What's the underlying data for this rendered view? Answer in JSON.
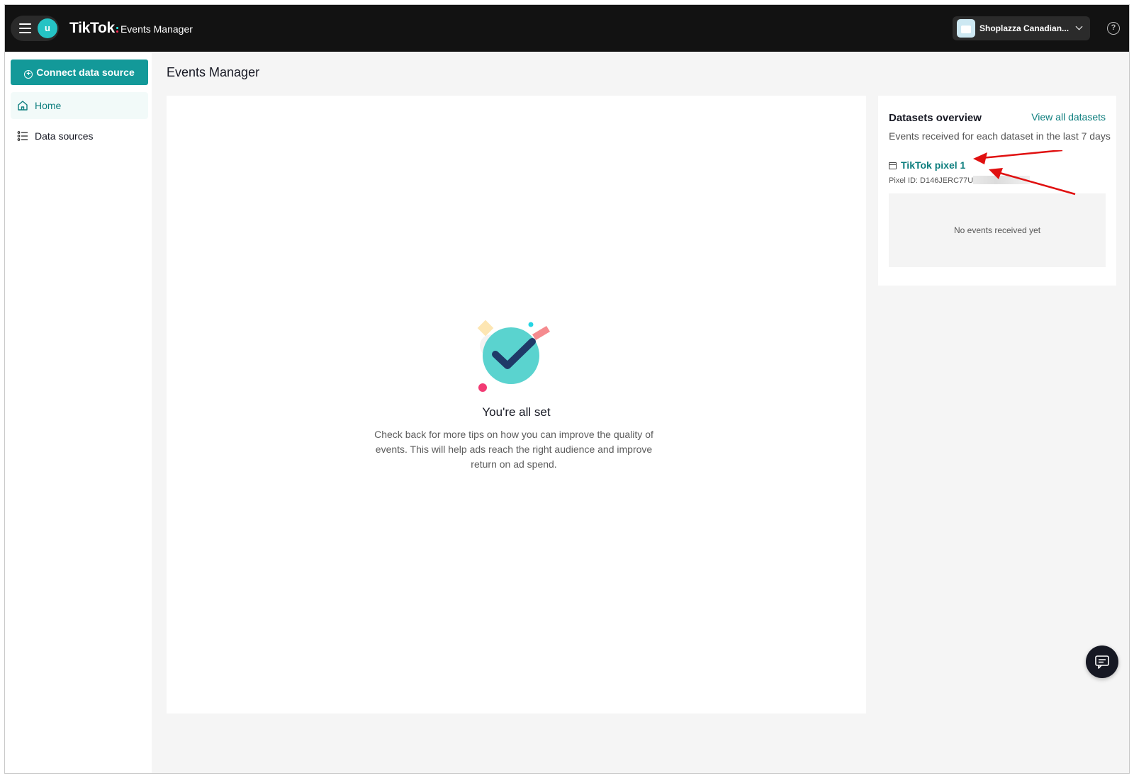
{
  "header": {
    "logo_text": "TikTok",
    "product_name": "Events Manager",
    "avatar_initial": "u",
    "account_name": "Shoplazza Canadian...",
    "help_label": "?"
  },
  "sidebar": {
    "connect_button_label": "Connect data source",
    "items": [
      {
        "label": "Home",
        "icon": "home-icon",
        "active": true
      },
      {
        "label": "Data sources",
        "icon": "list-icon",
        "active": false
      }
    ]
  },
  "main": {
    "page_title": "Events Manager",
    "empty_state": {
      "title": "You're all set",
      "description": "Check back for more tips on how you can improve the quality of events. This will help ads reach the right audience and improve return on ad spend.",
      "illustration": "checkmark-illustration"
    }
  },
  "datasets": {
    "title": "Datasets overview",
    "view_all_label": "View all datasets",
    "subtitle": "Events received for each dataset in the last 7 days",
    "pixel_name": "TikTok pixel 1",
    "pixel_id_text": "Pixel ID: D146JERC77U",
    "no_events_text": "No events received yet"
  },
  "colors": {
    "brand_teal": "#139999",
    "link_teal": "#0d7e7e",
    "topbar": "#121212",
    "annotation_red": "#e01010"
  },
  "chat_button_icon": "chat-icon"
}
